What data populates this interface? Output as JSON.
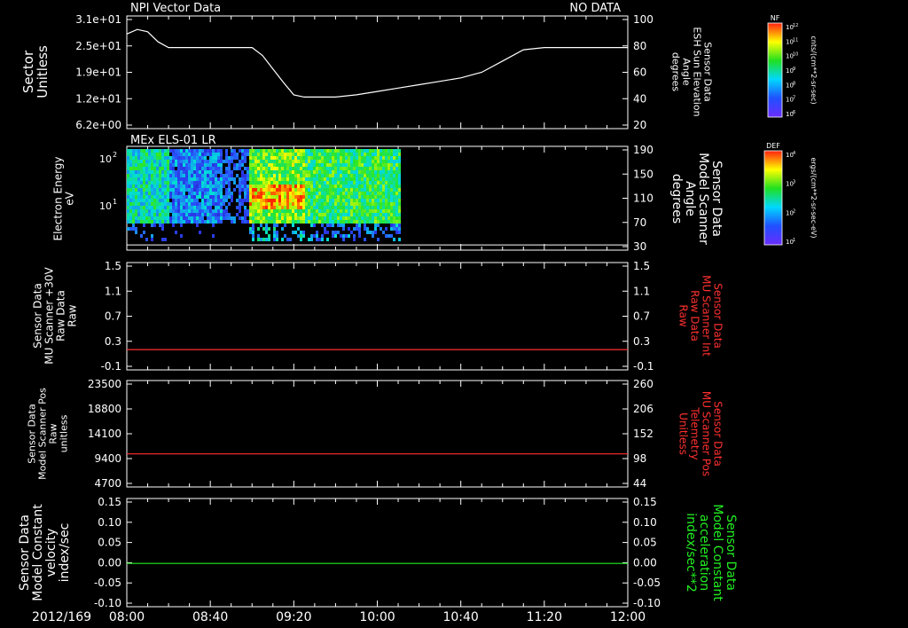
{
  "colors": {
    "frame": "#ffffff",
    "text": "#ffffff",
    "red": "#ff3030",
    "green": "#22ee22",
    "background": "#000000"
  },
  "header": {
    "left_title": "NPI Vector Data",
    "right_status": "NO DATA",
    "date_label": "2012/169"
  },
  "colorbars": [
    {
      "top_label": "NF",
      "unit_label": "cnts/(cm**2-sr-sec)",
      "tick_labels": [
        "10^12",
        "10^11",
        "10^10",
        "10^9",
        "10^8",
        "10^7",
        "10^6"
      ]
    },
    {
      "top_label": "DEF",
      "unit_label": "ergs/(cm**2-sr-sec-eV)",
      "tick_labels": [
        "10^4",
        "10^3",
        "10^2",
        "10^1"
      ]
    }
  ],
  "chart_data": [
    {
      "type": "line",
      "panel": 1,
      "ylabel_left": [
        "Sector",
        "Unitless"
      ],
      "ylabel_right": [
        "Sensor Data",
        "ESH Sun Elevation",
        "Angle",
        "degrees"
      ],
      "yticks_left": [
        "3.1e+01",
        "2.5e+01",
        "1.9e+01",
        "1.2e+01",
        "6.2e+00"
      ],
      "yticks_right": [
        "100",
        "80",
        "60",
        "40",
        "20"
      ],
      "ylim_right": [
        0,
        100
      ],
      "series": [
        {
          "color": "#ffffff",
          "x_minutes": [
            0,
            5,
            10,
            15,
            20,
            25,
            30,
            35,
            40,
            45,
            50,
            55,
            60,
            65,
            70,
            75,
            80,
            85,
            90,
            100,
            110,
            120,
            130,
            140,
            150,
            160,
            170,
            180,
            190,
            200,
            210,
            220,
            230,
            240
          ],
          "values": [
            84,
            88,
            86,
            77,
            72,
            72,
            72,
            72,
            72,
            72,
            72,
            72,
            72,
            65,
            53,
            41,
            30,
            28,
            28,
            28,
            30,
            33,
            36,
            39,
            42,
            45,
            50,
            60,
            70,
            72,
            72,
            72,
            72,
            72
          ]
        }
      ]
    },
    {
      "type": "heatmap",
      "panel": 2,
      "panel_title": "MEx ELS-01 LR",
      "ylabel_left": [
        "Electron Energy",
        "eV"
      ],
      "ylabel_right": [
        "Sensor Data",
        "Model Scanner",
        "Angle",
        "degrees"
      ],
      "yticks_left": [
        "10^2",
        "10^1"
      ],
      "yticks_right": [
        "190",
        "150",
        "110",
        "70",
        "30"
      ],
      "ylim_right": [
        -10,
        190
      ],
      "heatmap_x_range_minutes": [
        0,
        130
      ],
      "scanner_angle_line": 0,
      "regions": [
        {
          "x_minutes": [
            0,
            20
          ],
          "intensity": 0.45
        },
        {
          "x_minutes": [
            20,
            45
          ],
          "intensity": 0.25
        },
        {
          "x_minutes": [
            45,
            58
          ],
          "intensity": 0.15
        },
        {
          "x_minutes": [
            58,
            85
          ],
          "intensity": 0.65
        },
        {
          "x_minutes": [
            85,
            130
          ],
          "intensity": 0.55
        }
      ]
    },
    {
      "type": "line",
      "panel": 3,
      "ylabel_left": [
        "Sensor Data",
        "MU Scanner +30V",
        "Raw Data",
        "Raw"
      ],
      "ylabel_right": [
        "Sensor Data",
        "MU Scanner Int",
        "Raw Data",
        "Raw"
      ],
      "yticks_left": [
        "1.5",
        "1.1",
        "0.7",
        "0.3",
        "-0.1"
      ],
      "yticks_right": [
        "1.5",
        "1.1",
        "0.7",
        "0.3",
        "-0.1"
      ],
      "ylim": [
        -0.35,
        1.5
      ],
      "series": [
        {
          "color": "#ff3030",
          "constant": 0.0
        }
      ]
    },
    {
      "type": "line",
      "panel": 4,
      "ylabel_left": [
        "Sensor Data",
        "Model Scanner Pos",
        "Raw",
        "unitless"
      ],
      "ylabel_right": [
        "Sensor Data",
        "MU Scanner Pos",
        "Telemetry",
        "Unitless"
      ],
      "yticks_left": [
        "23500",
        "18800",
        "14100",
        "9400",
        "4700"
      ],
      "yticks_right": [
        "260",
        "206",
        "152",
        "98",
        "44"
      ],
      "ylim": [
        0,
        23500
      ],
      "series": [
        {
          "color": "#ff3030",
          "constant": 7300
        }
      ]
    },
    {
      "type": "line",
      "panel": 5,
      "ylabel_left": [
        "Sensor Data",
        "Model Constant",
        "velocity",
        "index/sec"
      ],
      "ylabel_right": [
        "Sensor Data",
        "Model Constant",
        "acceleration",
        "index/sec**2"
      ],
      "yticks_left": [
        "0.15",
        "0.10",
        "0.05",
        "0.00",
        "-0.05",
        "-0.10"
      ],
      "yticks_right": [
        "0.15",
        "0.10",
        "0.05",
        "0.00",
        "-0.05",
        "-0.10"
      ],
      "ylim": [
        -0.1,
        0.15
      ],
      "series": [
        {
          "color": "#22ee22",
          "constant": 0.0
        }
      ]
    }
  ],
  "time_axis": {
    "tick_labels": [
      "08:00",
      "08:40",
      "09:20",
      "10:00",
      "10:40",
      "11:20",
      "12:00"
    ],
    "range_minutes": [
      0,
      240
    ]
  }
}
